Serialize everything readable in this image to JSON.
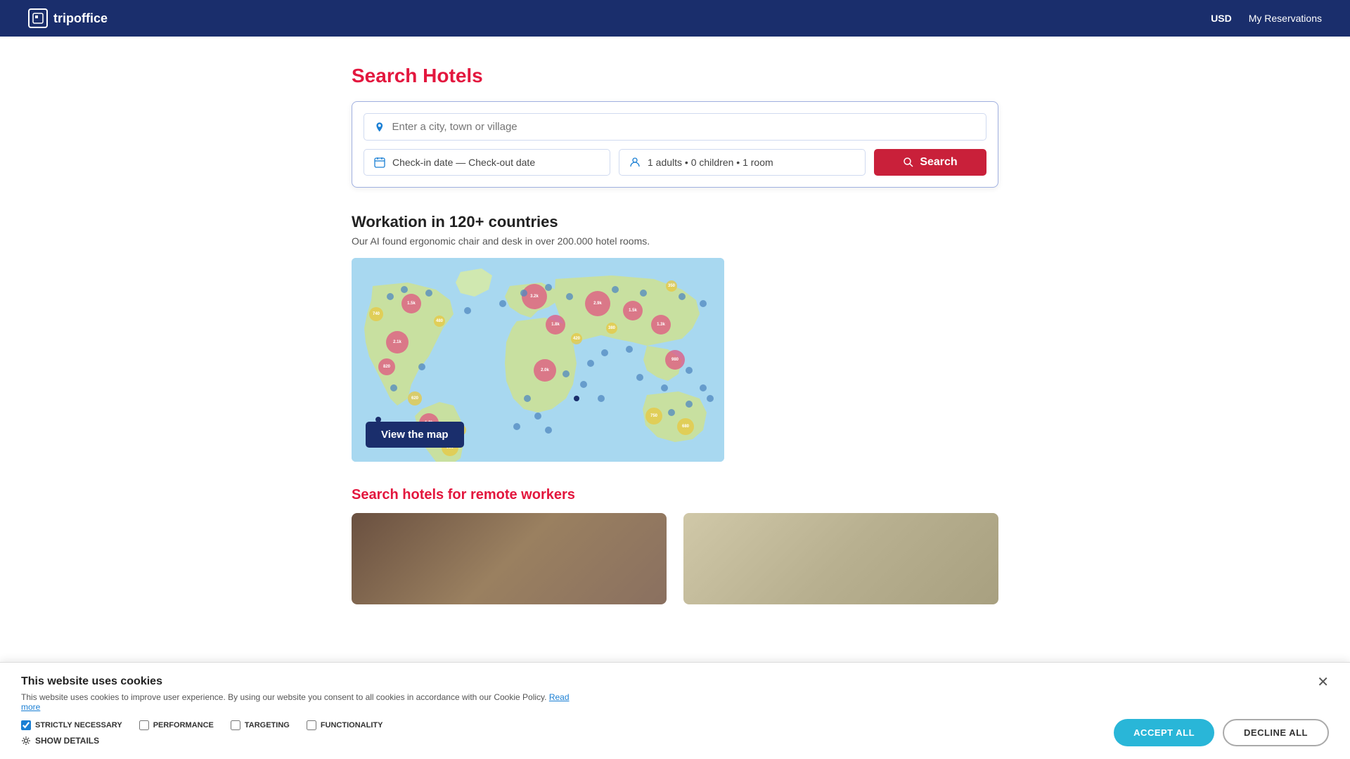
{
  "header": {
    "logo_text": "tripoffice",
    "currency": "USD",
    "my_reservations": "My Reservations"
  },
  "search": {
    "title_plain": "Search ",
    "title_colored": "Hotels",
    "location_placeholder": "Enter a city, town or village",
    "date_placeholder": "Check-in date — Check-out date",
    "guests_value": "1 adults • 0 children • 1 room",
    "search_button": "Search"
  },
  "workation": {
    "title": "Workation in 120+ countries",
    "subtitle": "Our AI found ergonomic chair and desk in over 200.000 hotel rooms.",
    "view_map_button": "View the map"
  },
  "remote_workers": {
    "title_plain": "Search hotels for ",
    "title_colored": "remote workers"
  },
  "cookie": {
    "title": "This website uses cookies",
    "description": "This website uses cookies to improve user experience. By using our website you consent to all cookies in accordance with our Cookie Policy.",
    "read_more": "Read more",
    "strictly_necessary": "Strictly Necessary",
    "performance": "Performance",
    "targeting": "Targeting",
    "functionality": "Functionality",
    "show_details": "Show Details",
    "accept_all": "Accept All",
    "decline_all": "Decline All"
  }
}
